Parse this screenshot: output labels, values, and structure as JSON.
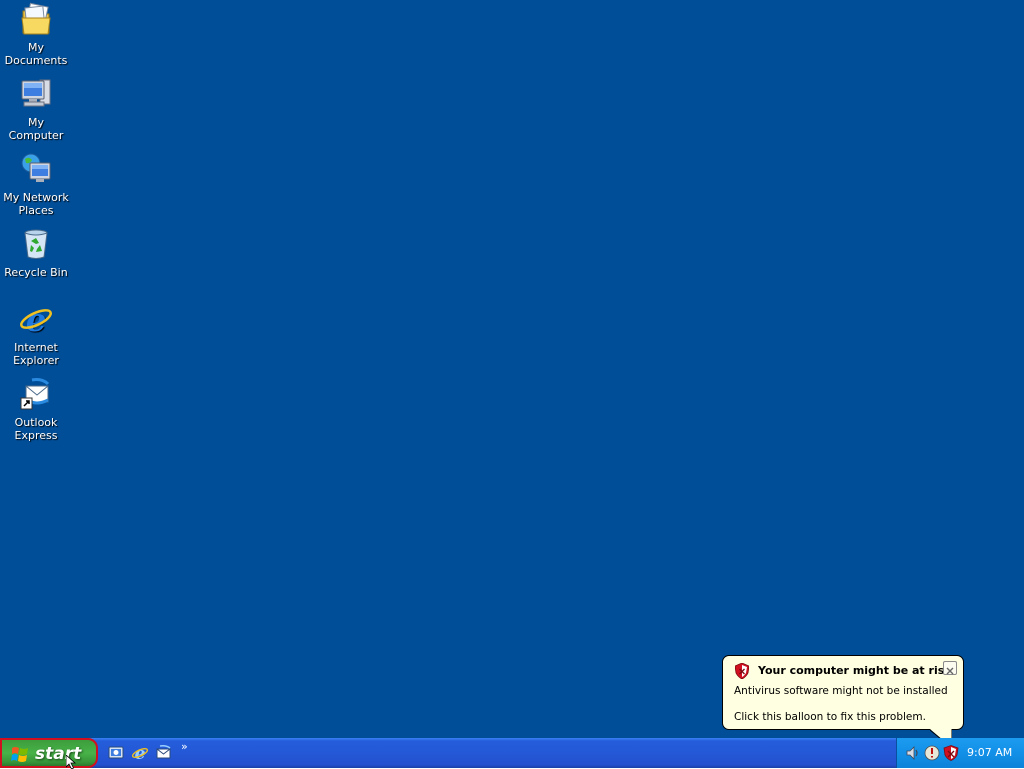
{
  "desktop": {
    "background": "#004e98",
    "icons": [
      {
        "label": "My Documents",
        "icon": "my-documents-icon"
      },
      {
        "label": "My Computer",
        "icon": "my-computer-icon"
      },
      {
        "label": "My Network Places",
        "icon": "my-network-places-icon"
      },
      {
        "label": "Recycle Bin",
        "icon": "recycle-bin-icon"
      },
      {
        "label": "Internet Explorer",
        "icon": "internet-explorer-icon"
      },
      {
        "label": "Outlook Express",
        "icon": "outlook-express-icon"
      }
    ]
  },
  "taskbar": {
    "start_label": "start",
    "quick_launch": [
      {
        "icon": "show-desktop-icon"
      },
      {
        "icon": "internet-explorer-icon"
      },
      {
        "icon": "outlook-express-icon"
      }
    ],
    "quick_launch_more": "»",
    "tray": {
      "icons": [
        "volume-icon",
        "security-alert-icon",
        "security-center-shield-icon"
      ],
      "clock": "9:07 AM"
    }
  },
  "balloon": {
    "title": "Your computer might be at risk",
    "line1": "Antivirus software might not be installed",
    "line2": "Click this balloon to fix this problem."
  },
  "colors": {
    "taskbar_blue": "#245ddb",
    "start_green": "#3fa33f",
    "tray_blue": "#1290e8",
    "balloon_bg": "#ffffe1",
    "highlight_red": "#d01020"
  }
}
